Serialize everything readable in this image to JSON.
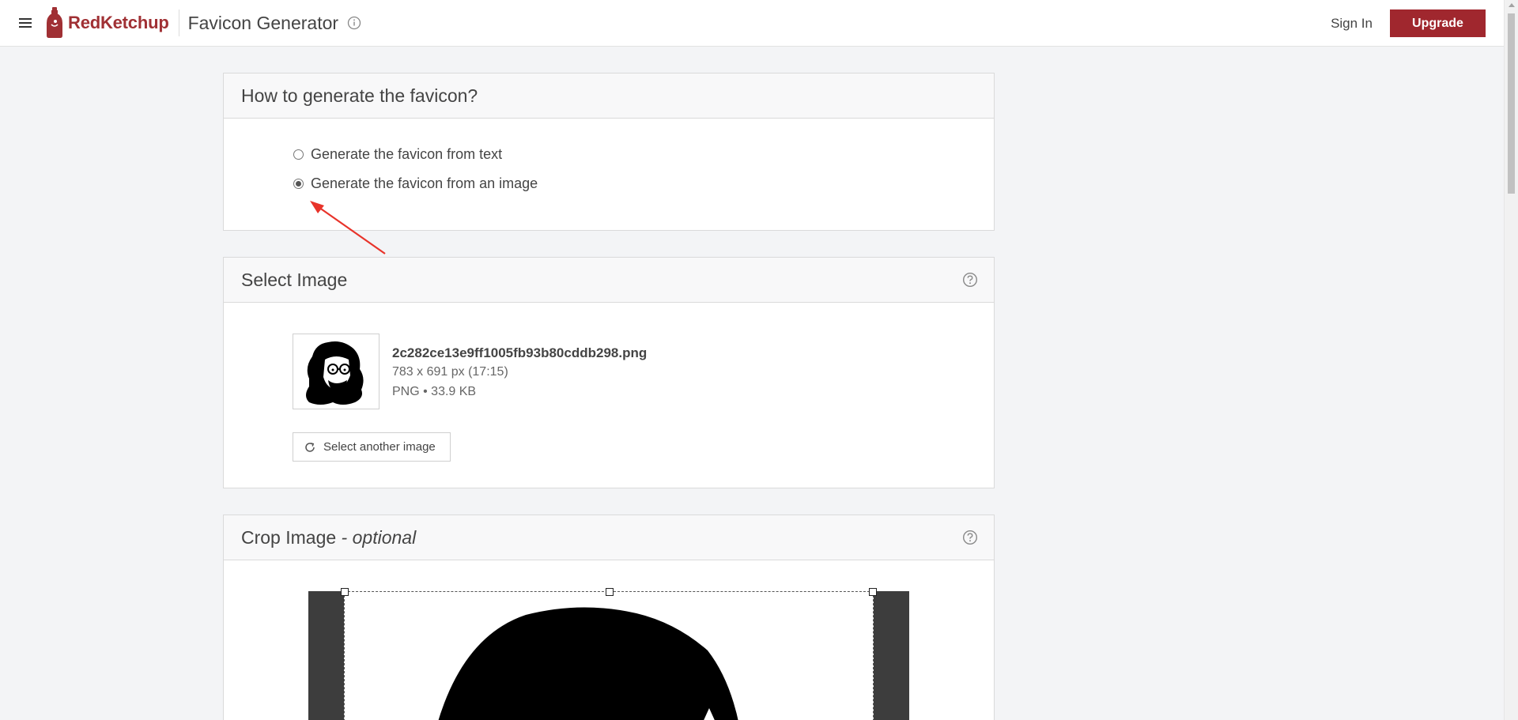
{
  "header": {
    "brand": "RedKetchup",
    "app_title": "Favicon Generator",
    "sign_in": "Sign In",
    "upgrade": "Upgrade"
  },
  "section_method": {
    "title": "How to generate the favicon?",
    "options": [
      {
        "label": "Generate the favicon from text",
        "checked": false
      },
      {
        "label": "Generate the favicon from an image",
        "checked": true
      }
    ]
  },
  "section_select": {
    "title": "Select Image",
    "file": {
      "name": "2c282ce13e9ff1005fb93b80cddb298.png",
      "dimensions": "783 x 691 px (17:15)",
      "meta": "PNG • 33.9 KB"
    },
    "button": "Select another image"
  },
  "section_crop": {
    "title": "Crop Image",
    "title_suffix": " - optional"
  },
  "colors": {
    "brand": "#a03034",
    "upgrade_bg": "#a0272e",
    "annotation_arrow": "#e8332a"
  },
  "icons": [
    "menu-icon",
    "ketchup-bottle-logo-icon",
    "info-icon",
    "help-icon",
    "refresh-icon",
    "radio-icon"
  ]
}
